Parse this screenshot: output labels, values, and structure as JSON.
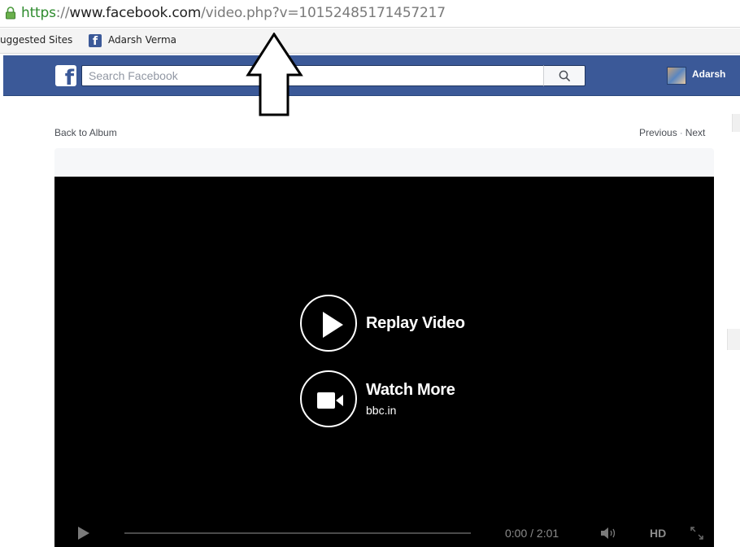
{
  "browser": {
    "url_scheme": "https",
    "url_sep": "://",
    "url_host": "www.facebook.com",
    "url_path": "/video.php?v=10152485171457217",
    "bookmarks": [
      {
        "label": "uggested Sites"
      },
      {
        "label": "Adarsh Verma"
      }
    ]
  },
  "fb_bar": {
    "search_placeholder": "Search Facebook",
    "user_name": "Adarsh",
    "colors": {
      "brand": "#3b5998"
    }
  },
  "page": {
    "back_label": "Back to Album",
    "previous_label": "Previous",
    "next_label": "Next",
    "separator": "·"
  },
  "video": {
    "replay_label": "Replay Video",
    "watch_more_label": "Watch More",
    "source": "bbc.in",
    "time": "0:00 / 2:01",
    "hd_label": "HD",
    "progress": 0
  },
  "icons": [
    "lock-icon",
    "facebook-logo-icon",
    "search-icon",
    "play-icon",
    "camera-icon",
    "volume-icon",
    "fullscreen-icon",
    "arrow-up-icon"
  ]
}
